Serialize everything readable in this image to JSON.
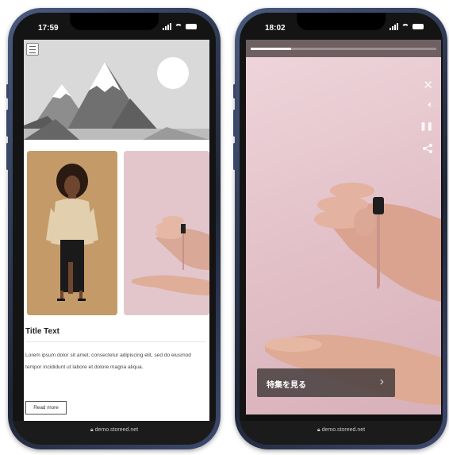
{
  "left_phone": {
    "status_time": "17:59",
    "title_text": "Title Text",
    "body_text": "Lorem ipsum dolor sit amet, consectetur adipiscing elit, sed do eiusmod tempor incididunt ut labore et dolore magna aliqua.",
    "read_more_label": "Read more",
    "url": "demo.storeed.net"
  },
  "right_phone": {
    "status_time": "18:02",
    "progress": 0.22,
    "cta_label": "特集を見る",
    "url": "demo.storeed.net"
  },
  "colors": {
    "cta_bg": "#463e3e",
    "video_bg": "#e3c1c9",
    "phone_frame": "#1f2638"
  },
  "icons": {
    "close": "close-icon",
    "sound": "volume-icon",
    "pause": "pause-icon",
    "share": "share-icon",
    "menu": "hamburger-menu-icon",
    "lock": "lock-icon",
    "chevron": "chevron-right-icon"
  }
}
